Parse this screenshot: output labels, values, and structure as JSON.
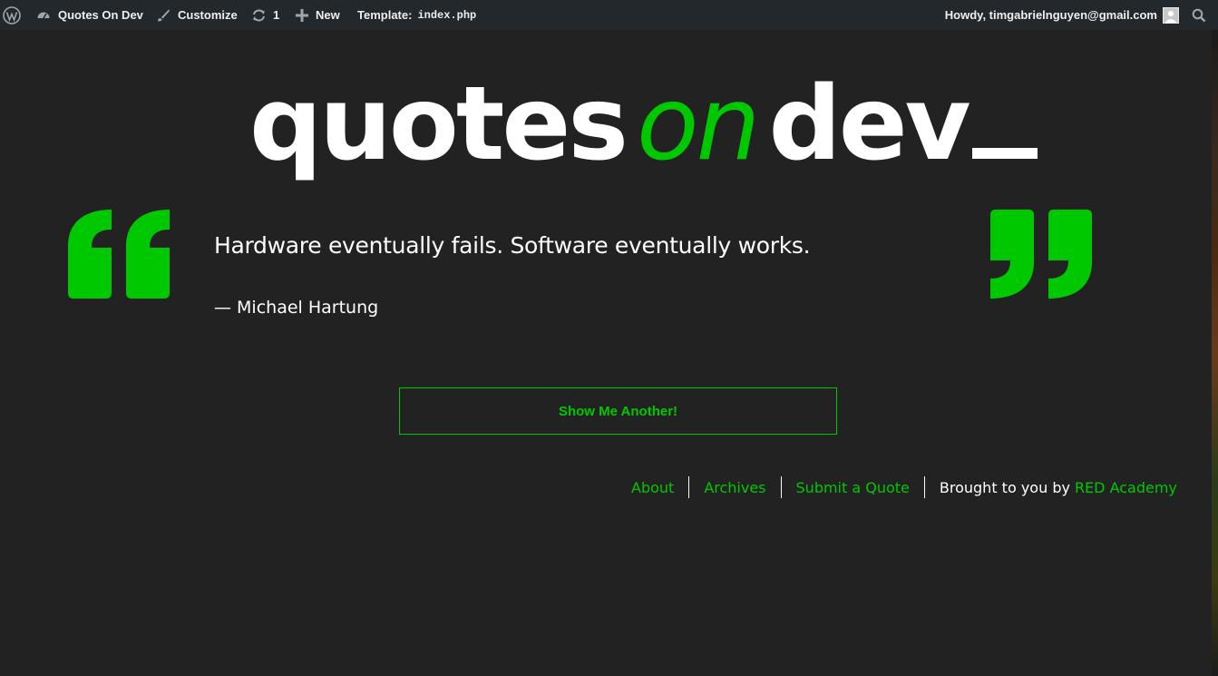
{
  "adminbar": {
    "site_name": "Quotes On Dev",
    "customize": "Customize",
    "updates_count": "1",
    "new_label": "New",
    "template_label": "Template:",
    "template_file": "index.php",
    "howdy": "Howdy, timgabrielnguyen@gmail.com",
    "icons": [
      "wordpress-logo-icon",
      "dashboard-icon",
      "brush-icon",
      "refresh-icon",
      "plus-icon",
      "avatar",
      "search-icon"
    ]
  },
  "logo": {
    "part1": "quotes",
    "part2": "on",
    "part3": "dev"
  },
  "quote": {
    "text": "Hardware eventually fails. Software eventually works.",
    "author": "— Michael Hartung"
  },
  "button": {
    "label": "Show Me Another!"
  },
  "footer": {
    "links": [
      "About",
      "Archives",
      "Submit a Quote"
    ],
    "credit_prefix": "Brought to you by",
    "credit_brand": "RED Academy"
  },
  "colors": {
    "accent": "#00c800",
    "background": "#222222",
    "adminbar": "#23282d",
    "text": "#ffffff"
  }
}
